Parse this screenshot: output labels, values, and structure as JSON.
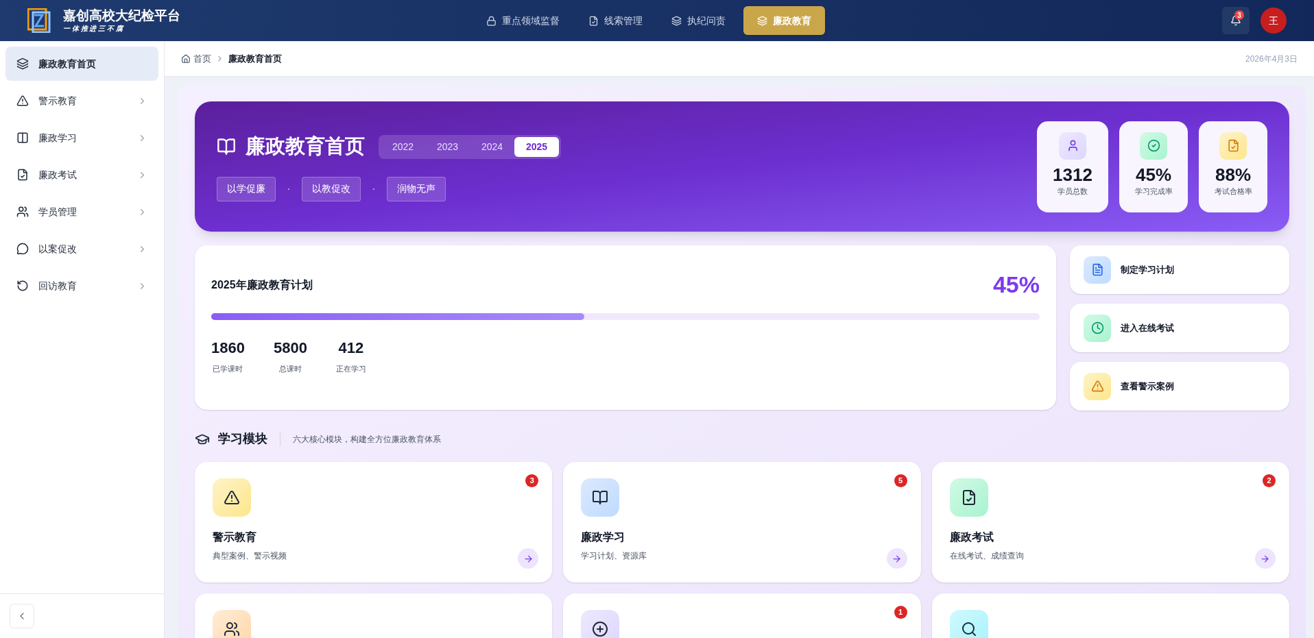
{
  "header": {
    "title": "嘉创高校大纪检平台",
    "subtitle": "一 体 推 进 三 不 腐",
    "nav": [
      {
        "label": "重点领域监督",
        "selected": false
      },
      {
        "label": "线索管理",
        "selected": false
      },
      {
        "label": "执纪问责",
        "selected": false
      },
      {
        "label": "廉政教育",
        "selected": true
      }
    ],
    "notification_count": "3",
    "avatar": "王"
  },
  "sidebar": {
    "items": [
      {
        "label": "廉政教育首页",
        "selected": true,
        "expandable": false
      },
      {
        "label": "警示教育",
        "selected": false,
        "expandable": true
      },
      {
        "label": "廉政学习",
        "selected": false,
        "expandable": true
      },
      {
        "label": "廉政考试",
        "selected": false,
        "expandable": true
      },
      {
        "label": "学员管理",
        "selected": false,
        "expandable": true
      },
      {
        "label": "以案促改",
        "selected": false,
        "expandable": true
      },
      {
        "label": "回访教育",
        "selected": false,
        "expandable": true
      }
    ]
  },
  "breadcrumb": [
    "首页",
    "廉政教育首页"
  ],
  "date": "2026年4月3日",
  "hero": {
    "title": "廉政教育首页",
    "years": [
      {
        "label": "2022",
        "selected": false
      },
      {
        "label": "2023",
        "selected": false
      },
      {
        "label": "2024",
        "selected": false
      },
      {
        "label": "2025",
        "selected": true
      }
    ],
    "tags": [
      "以学促廉",
      "以教促改",
      "润物无声"
    ],
    "stats": [
      {
        "value": "1312",
        "label": "学员总数"
      },
      {
        "value": "45%",
        "label": "学习完成率"
      },
      {
        "value": "88%",
        "label": "考试合格率"
      }
    ]
  },
  "plan": {
    "title": "2025年廉政教育计划",
    "percent": "45%",
    "level": 0.45,
    "metrics": [
      {
        "value": "1860",
        "label": "已学课时"
      },
      {
        "value": "5800",
        "label": "总课时"
      },
      {
        "value": "412",
        "label": "正在学习"
      }
    ]
  },
  "quick_actions": [
    "制定学习计划",
    "进入在线考试",
    "查看警示案例"
  ],
  "modules_section": {
    "title": "学习模块",
    "subtitle": "六大核心模块，构建全方位廉政教育体系"
  },
  "modules": [
    {
      "kind": "module",
      "title": "警示教育",
      "desc": "典型案例、警示视频",
      "badge": "3"
    },
    {
      "kind": "module",
      "title": "廉政学习",
      "desc": "学习计划、资源库",
      "badge": "5"
    },
    {
      "kind": "module",
      "title": "廉政考试",
      "desc": "在线考试、成绩查询",
      "badge": "2"
    },
    {
      "kind": "module"
    },
    {
      "kind": "module",
      "badge": "1"
    },
    {
      "kind": "module"
    }
  ]
}
